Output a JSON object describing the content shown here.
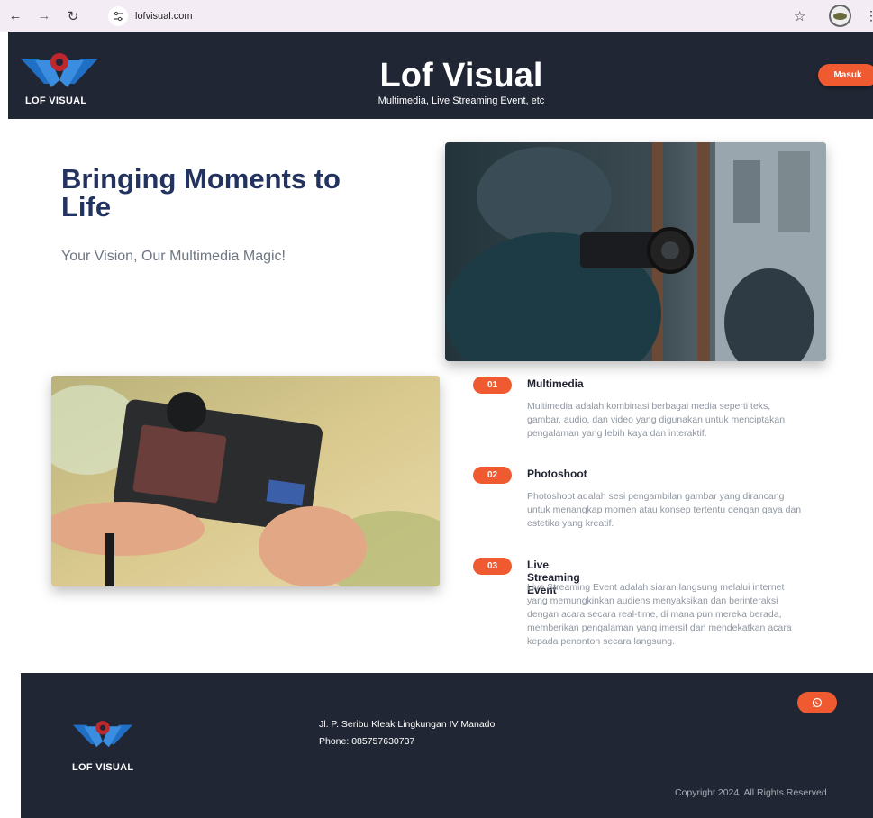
{
  "browser": {
    "url": "lofvisual.com",
    "back_icon": "arrow-left",
    "forward_icon": "arrow-right",
    "reload_icon": "reload",
    "site_settings_icon": "tune",
    "bookmark_icon": "star",
    "menu_icon": "kebab"
  },
  "header": {
    "logo_text": "LOF VISUAL",
    "title": "Lof Visual",
    "subtitle": "Multimedia, Live Streaming Event, etc",
    "login_label": "Masuk"
  },
  "hero": {
    "title": "Bringing Moments to Life",
    "tagline": "Your Vision, Our Multimedia Magic!"
  },
  "services": [
    {
      "number": "01",
      "title": "Multimedia",
      "description": "Multimedia adalah kombinasi berbagai media seperti teks, gambar, audio, dan video yang digunakan untuk menciptakan pengalaman yang lebih kaya dan interaktif."
    },
    {
      "number": "02",
      "title": "Photoshoot",
      "description": "Photoshoot adalah sesi pengambilan gambar yang dirancang untuk menangkap momen atau konsep tertentu dengan gaya dan estetika yang kreatif."
    },
    {
      "number": "03",
      "title": "Live Streaming Event",
      "description": "Live Streaming Event adalah siaran langsung melalui internet yang memungkinkan audiens menyaksikan dan berinteraksi dengan acara secara real-time, di mana pun mereka berada, memberikan pengalaman yang imersif dan mendekatkan acara kepada penonton secara langsung."
    }
  ],
  "footer": {
    "logo_text": "LOF VISUAL",
    "address": "Jl. P. Seribu Kleak Lingkungan IV Manado",
    "phone": "Phone: 085757630737",
    "copyright": "Copyright 2024. All Rights Reserved",
    "whatsapp_icon": "whatsapp"
  },
  "colors": {
    "accent": "#ef5a30",
    "dark": "#202633",
    "title_blue": "#23335f"
  }
}
